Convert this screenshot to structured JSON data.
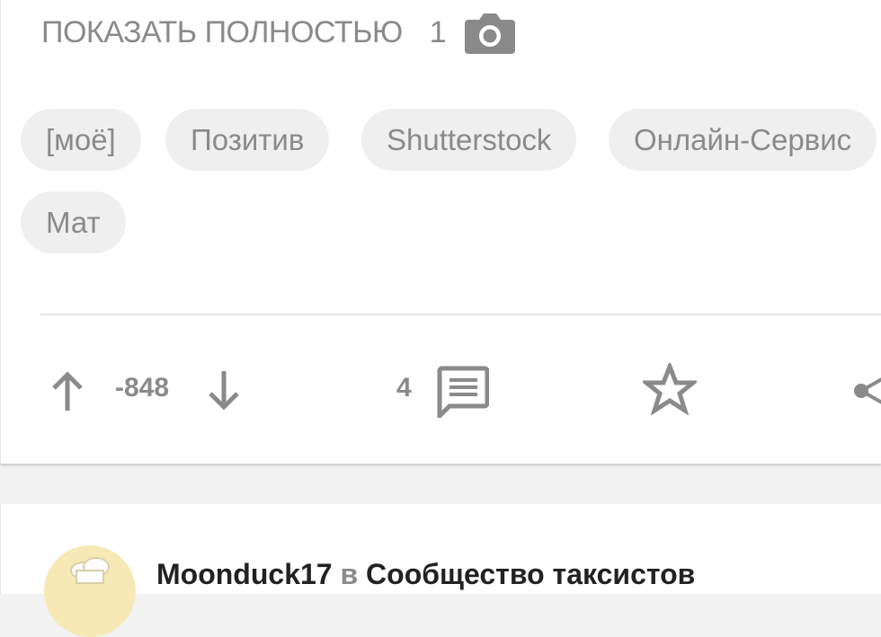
{
  "post": {
    "show_more_label": "ПОКАЗАТЬ ПОЛНОСТЬЮ",
    "photo_count": "1",
    "tags": [
      {
        "label": "[моё]"
      },
      {
        "label": "Позитив"
      },
      {
        "label": "Shutterstock"
      },
      {
        "label": "Онлайн-Сервис"
      },
      {
        "label": "Мат"
      }
    ],
    "rating": "-848",
    "comments_count": "4"
  },
  "next_post": {
    "author": "Moonduck17",
    "in_word": "в",
    "community": "Сообщество таксистов"
  },
  "icons": {
    "camera": "camera-icon",
    "upvote": "arrow-up-icon",
    "downvote": "arrow-down-icon",
    "comments": "comment-icon",
    "save": "star-icon",
    "share": "share-icon"
  },
  "colors": {
    "text_muted": "#8a8a8a",
    "tag_bg": "#efefef",
    "page_bg": "#f2f2f2",
    "avatar_bg": "#f7e9b6"
  }
}
